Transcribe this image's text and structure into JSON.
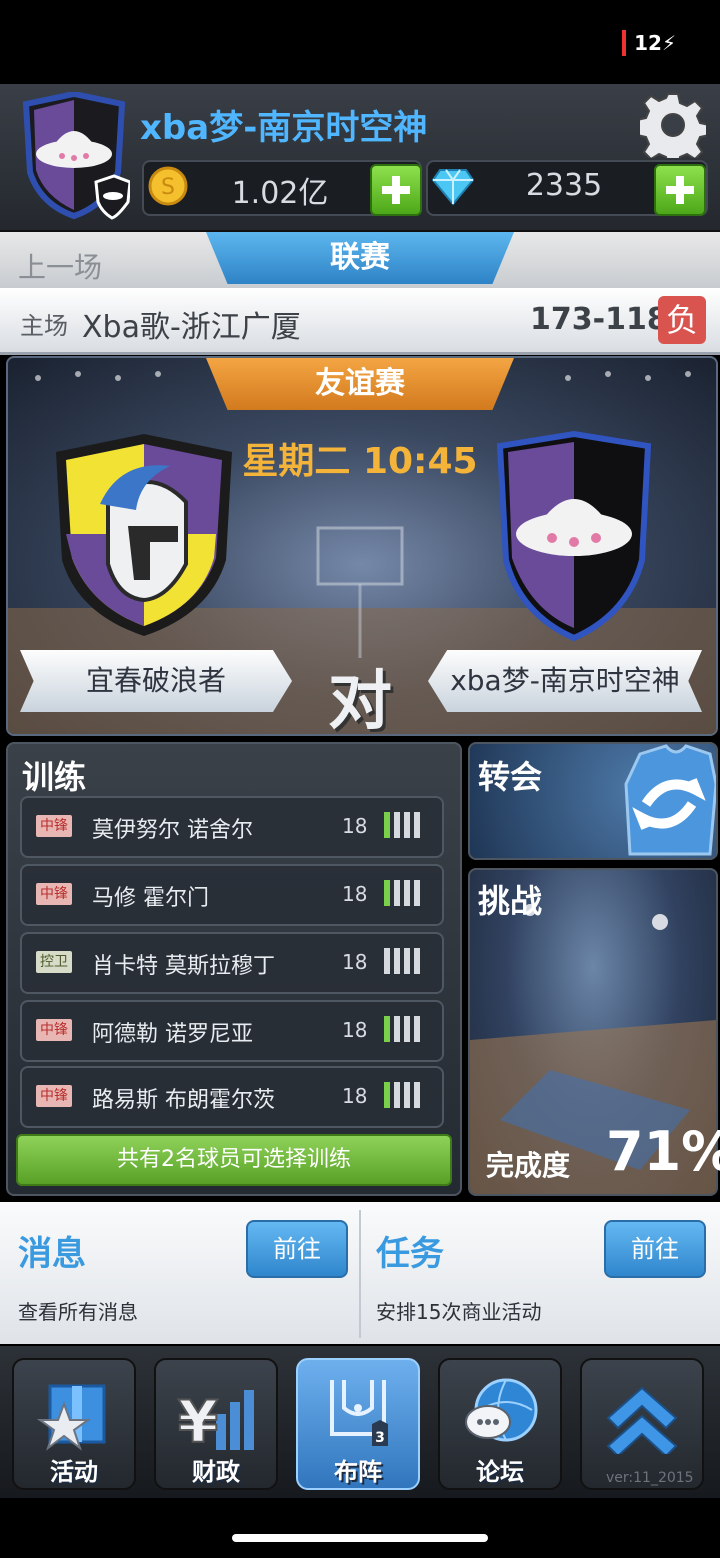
{
  "status_bar": {
    "battery": "12"
  },
  "header": {
    "team_name": "xba梦-南京时空神",
    "coins": "1.02亿",
    "diamonds": "2335"
  },
  "tabs": {
    "previous": "上一场",
    "league": "联赛"
  },
  "last_game": {
    "home_label": "主场",
    "opponent": "Xba歌-浙江广厦",
    "score": "173-118",
    "result": "负"
  },
  "match": {
    "type": "友谊赛",
    "time": "星期二 10:45",
    "vs": "对",
    "home_team": "宜春破浪者",
    "away_team": "xba梦-南京时空神"
  },
  "training": {
    "title": "训练",
    "players": [
      {
        "pos": "中锋",
        "name": "莫伊努尔 诺舍尔",
        "level": "18",
        "pos_type": "fw"
      },
      {
        "pos": "中锋",
        "name": "马修 霍尔门",
        "level": "18",
        "pos_type": "fw"
      },
      {
        "pos": "控卫",
        "name": "肖卡特 莫斯拉穆丁",
        "level": "18",
        "pos_type": "pg"
      },
      {
        "pos": "中锋",
        "name": "阿德勒 诺罗尼亚",
        "level": "18",
        "pos_type": "fw"
      },
      {
        "pos": "中锋",
        "name": "路易斯 布朗霍尔茨",
        "level": "18",
        "pos_type": "fw"
      }
    ],
    "note": "共有2名球员可选择训练"
  },
  "transfer": {
    "title": "转会"
  },
  "challenge": {
    "title": "挑战",
    "completion_label": "完成度",
    "completion": "71%"
  },
  "messages": {
    "title": "消息",
    "go": "前往",
    "sub": "查看所有消息"
  },
  "tasks": {
    "title": "任务",
    "go": "前往",
    "sub": "安排15次商业活动"
  },
  "nav": {
    "items": [
      {
        "label": "活动",
        "icon": "gift-star-icon"
      },
      {
        "label": "财政",
        "icon": "yen-chart-icon"
      },
      {
        "label": "布阵",
        "icon": "court-lineup-icon"
      },
      {
        "label": "论坛",
        "icon": "globe-chat-icon"
      },
      {
        "label": "",
        "icon": "chevron-up-icon"
      }
    ],
    "version": "ver:11_2015"
  },
  "colors": {
    "accent_blue": "#3a9ae0",
    "orange": "#f4a543",
    "green": "#7ad04a",
    "loss_red": "#d9534f"
  }
}
